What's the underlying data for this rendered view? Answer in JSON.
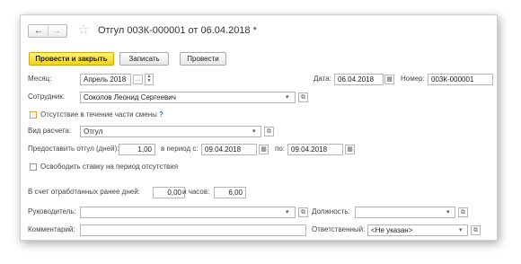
{
  "window": {
    "title": "Отгул 003К-000001 от 06.04.2018 *"
  },
  "toolbar": {
    "post_close_label": "Провести и закрыть",
    "save_label": "Записать",
    "post_label": "Провести"
  },
  "form": {
    "month_label": "Месяц:",
    "month_value": "Апрель 2018",
    "month_dots": "...",
    "date_label": "Дата:",
    "date_value": "06.04.2018",
    "number_label": "Номер:",
    "number_value": "003К-000001",
    "employee_label": "Сотрудник:",
    "employee_value": "Соколов Леонид Сергеевич",
    "partial_shift_label": "Отсутствие в течение части смены",
    "help_mark": "?",
    "calc_type_label": "Вид расчета:",
    "calc_type_value": "Отгул",
    "days_label": "Предоставить отгул (дней):",
    "days_value": "1,00",
    "period_from_label": "в период с:",
    "period_from_value": "09.04.2018",
    "period_to_label": "по:",
    "period_to_value": "09.04.2018",
    "free_rate_label": "Освободить ставку на период отсутствия",
    "worked_days_label": "В счет отработанных ранее дней:",
    "worked_days_value": "0,00",
    "hours_label": "и часов:",
    "hours_value": "6,00",
    "manager_label": "Руководитель:",
    "manager_value": "",
    "position_label": "Должность:",
    "position_value": "",
    "comment_label": "Комментарий:",
    "comment_value": "",
    "responsible_label": "Ответственный:",
    "responsible_value": "<Не указан>"
  },
  "colors": {
    "primary_button": "#f2d316",
    "border": "#b5b5b5"
  }
}
